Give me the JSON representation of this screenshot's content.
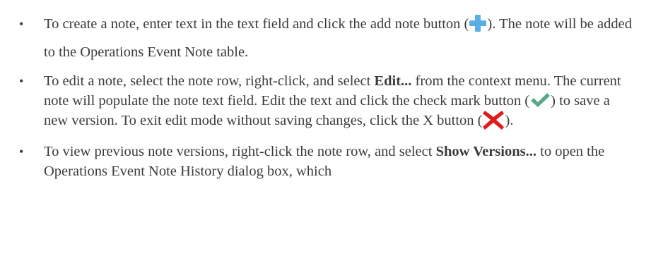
{
  "bullets": [
    {
      "text_before_icon": "To create a note, enter text in the text field and click the add note button (",
      "icon": "add-plus-icon",
      "text_after_icon": "). The note will be added to the Operations Event Note table."
    },
    {
      "text_before_bold": "To edit a note, select the note row, right-click, and select ",
      "bold": "Edit...",
      "text_mid": " from the context menu. The current note will populate the note text field. Edit the text and click the check mark button (",
      "icon_check": "check-mark-icon",
      "text_after_check": ") to save a new version. To exit edit mode without saving changes, click the X button (",
      "icon_x": "red-x-icon",
      "text_after_x": ")."
    },
    {
      "text_before_bold": "To view previous note versions, right-click the note row, and select ",
      "bold": "Show Versions...",
      "text_after_bold": " to open the Operations Event Note History dialog box, which"
    }
  ],
  "bullet_glyph": "•",
  "colors": {
    "text": "#3b3b3b",
    "plus_icon": "#5aaee6",
    "check_icon": "#5aa886",
    "x_icon": "#e01b1b"
  }
}
